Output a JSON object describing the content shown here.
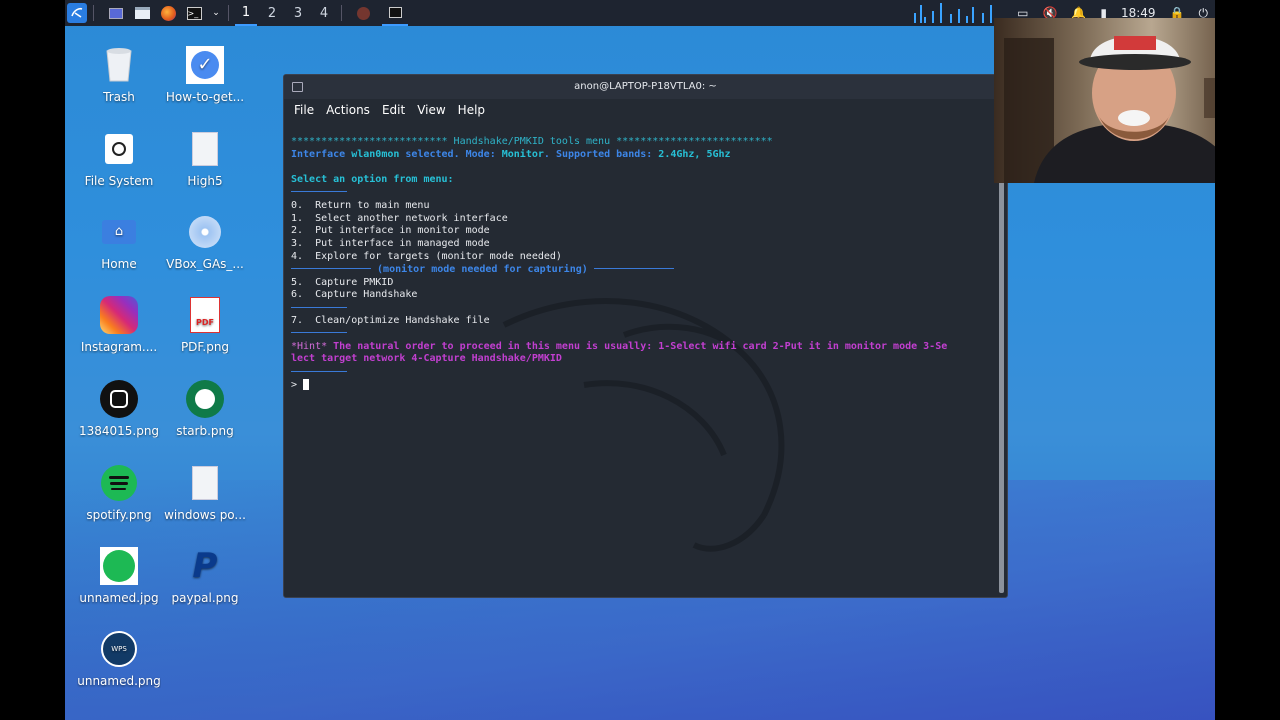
{
  "taskbar": {
    "workspaces": [
      "1",
      "2",
      "3",
      "4"
    ],
    "clock": "18:49"
  },
  "desktop": {
    "icons": [
      {
        "label": "Trash",
        "icon": "trash-icon"
      },
      {
        "label": "How-to-get...",
        "icon": "checkmark-icon"
      },
      {
        "label": "File System",
        "icon": "drive-icon"
      },
      {
        "label": "High5",
        "icon": "document-icon"
      },
      {
        "label": "Home",
        "icon": "home-folder-icon"
      },
      {
        "label": "VBox_GAs_...",
        "icon": "disc-icon"
      },
      {
        "label": "Instagram....",
        "icon": "instagram-icon"
      },
      {
        "label": "PDF.png",
        "icon": "pdf-icon"
      },
      {
        "label": "1384015.png",
        "icon": "instagram-dark-icon"
      },
      {
        "label": "starb.png",
        "icon": "starbucks-icon"
      },
      {
        "label": "spotify.png",
        "icon": "spotify-icon"
      },
      {
        "label": "windows po...",
        "icon": "document-icon"
      },
      {
        "label": "unnamed.jpg",
        "icon": "spotify-icon"
      },
      {
        "label": "paypal.png",
        "icon": "paypal-icon"
      },
      {
        "label": "unnamed.png",
        "icon": "wps-icon"
      }
    ]
  },
  "terminal": {
    "title": "anon@LAPTOP-P18VTLA0: ~",
    "menu": [
      "File",
      "Actions",
      "Edit",
      "View",
      "Help"
    ],
    "header_line": "************************** Handshake/PMKID tools menu **************************",
    "interface_prefix": "Interface ",
    "interface_name": "wlan0mon",
    "interface_mid": " selected. Mode: ",
    "interface_mode": "Monitor",
    "interface_bands_label": ". Supported bands: ",
    "interface_bands": "2.4Ghz, 5Ghz",
    "select_prompt": "Select an option from menu:",
    "options_a": [
      "0.  Return to main menu",
      "1.  Select another network interface",
      "2.  Put interface in monitor mode",
      "3.  Put interface in managed mode",
      "4.  Explore for targets (monitor mode needed)"
    ],
    "capture_divider": "(monitor mode needed for capturing)",
    "options_b": [
      "5.  Capture PMKID",
      "6.  Capture Handshake"
    ],
    "options_c": [
      "7.  Clean/optimize Handshake file"
    ],
    "hint_label": "*Hint*",
    "hint_text_1": " The natural order to proceed in this menu is usually: 1-Select wifi card 2-Put it in monitor mode 3-Se",
    "hint_text_2": "lect target network 4-Capture Handshake/PMKID",
    "prompt": ">"
  },
  "colors": {
    "accent": "#3d86e8",
    "cyan": "#2fb3c8",
    "hint": "#c23fd0",
    "terminal_bg": "#242a33"
  }
}
